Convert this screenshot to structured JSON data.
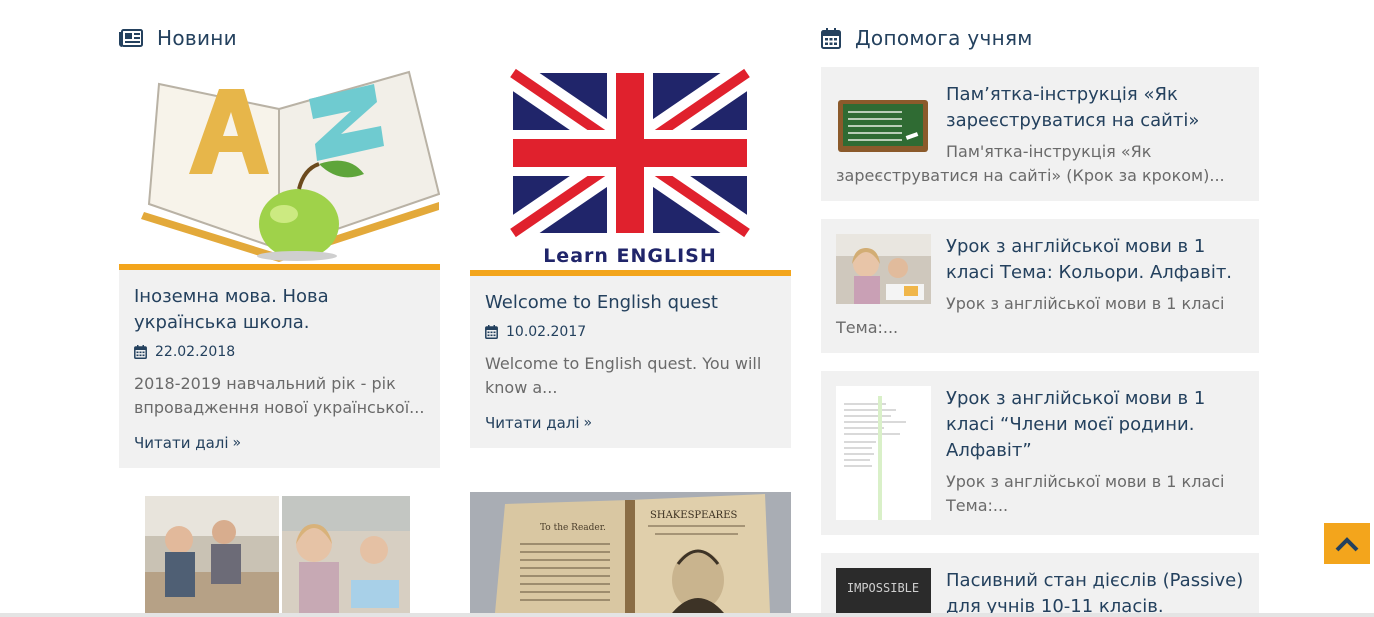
{
  "news": {
    "heading": "Новини",
    "cards": [
      {
        "title": "Іноземна мова. Нова українська школа.",
        "date": "22.02.2018",
        "excerpt": "2018-2019 навчальний рік - рік впровадження нової української...",
        "more": "Читати далі"
      },
      {
        "title": "Welcome to English quest",
        "date": "10.02.2017",
        "excerpt": "Welcome to English quest. You will know a...",
        "more": "Читати далі",
        "image_caption": "Learn ENGLISH"
      }
    ]
  },
  "help": {
    "heading": "Допомога учням",
    "items": [
      {
        "title": "Пам’ятка-інструкція «Як зареєструватися на сайті»",
        "excerpt": "Пам'ятка-інструкція «Як зареєструватися на сайті» (Крок за кроком)..."
      },
      {
        "title": "Урок з англійської мови в 1 класі Тема: Кольори. Алфавіт.",
        "excerpt": "Урок з англійської мови в 1 класі Тема:..."
      },
      {
        "title": "Урок з англійської мови в 1 класі “Члени моєї родини. Алфавіт”",
        "excerpt": "Урок з англійської мови в 1 класі Тема:..."
      },
      {
        "title": "Пасивний стан дієслів (Passive) для учнів 10-11 класів."
      }
    ]
  },
  "colors": {
    "accent": "#f3a51c",
    "heading": "#24415e",
    "card_bg": "#f1f1f1"
  },
  "icons": {
    "news": "newspaper-icon",
    "help": "calendar-icon",
    "date": "calendar-icon",
    "more": "double-chevron-right-icon",
    "to_top": "chevron-up-icon"
  }
}
